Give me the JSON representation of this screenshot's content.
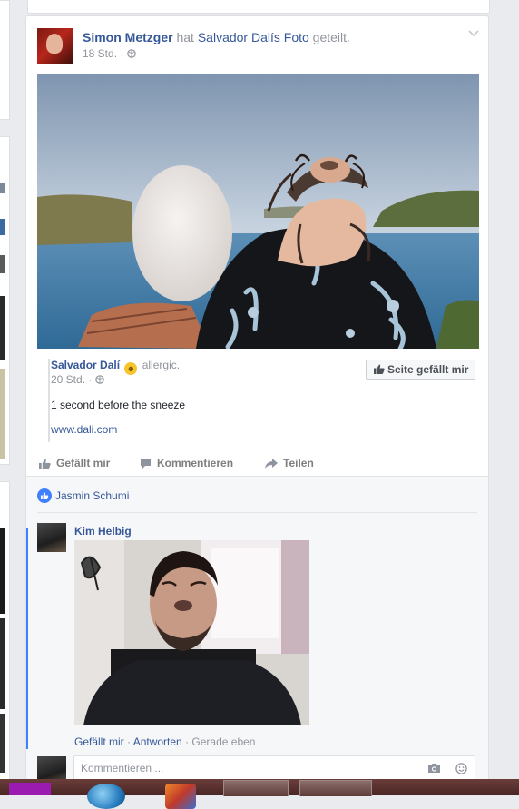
{
  "post": {
    "author": "Simon Metzger",
    "verb": "hat",
    "shared_owner": "Salvador Dalís",
    "object": "Foto",
    "suffix": "geteilt.",
    "time": "18 Std.",
    "separator": "·",
    "shared": {
      "page_name": "Salvador Dalí",
      "feeling": "allergic.",
      "time": "20 Std.",
      "text": "1 second before the sneeze",
      "link": "www.dali.com",
      "like_page_label": "Seite gefällt mir"
    },
    "actions": {
      "like": "Gefällt mir",
      "comment": "Kommentieren",
      "share": "Teilen"
    }
  },
  "ufi": {
    "liker": "Jasmin Schumi",
    "comment": {
      "author": "Kim Helbig",
      "like": "Gefällt mir",
      "reply": "Antworten",
      "time": "Gerade eben",
      "separator": "·"
    },
    "input_placeholder": "Kommentieren ..."
  },
  "colors": {
    "link": "#365899",
    "meta": "#90949c",
    "like_blue": "#4080ff",
    "background": "#e9ebee"
  },
  "icons": [
    "globe-icon",
    "chevron-down-icon",
    "thumbs-up-icon",
    "comment-icon",
    "share-arrow-icon",
    "camera-icon",
    "emoji-icon",
    "smiley-icon"
  ]
}
